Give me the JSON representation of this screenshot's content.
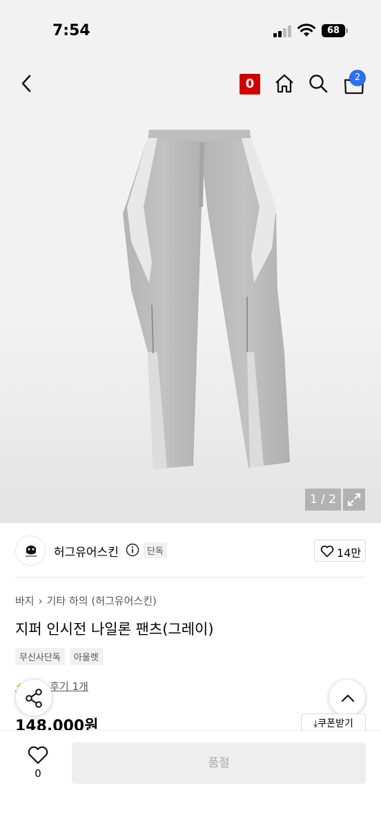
{
  "status_bar": {
    "time": "7:54",
    "battery": "68"
  },
  "header": {
    "cart_count": "2",
    "zero_badge": "0"
  },
  "gallery": {
    "pager": "1 / 2"
  },
  "brand": {
    "name": "허그유어스킨",
    "exclusive_tag": "단독",
    "likes": "14만"
  },
  "product": {
    "breadcrumb": [
      "바지",
      "기타 하의 (허그유어스킨)"
    ],
    "title": "지퍼 인시전 나일론 팬츠(그레이)",
    "tags": [
      "무신사단독",
      "아울렛"
    ],
    "review": "후기 1개",
    "price": "148,000원",
    "coupon_label": "쿠폰받기"
  },
  "bottom_bar": {
    "wish_count": "0",
    "buy_label": "품절"
  },
  "colors": {
    "accent_red": "#d10000",
    "badge_blue": "#2b6ff2",
    "star": "#f5b800"
  },
  "icons": [
    "back-icon",
    "home-icon",
    "search-icon",
    "cart-icon",
    "info-icon",
    "heart-icon",
    "share-icon",
    "chevron-up-icon",
    "expand-icon",
    "download-icon"
  ]
}
